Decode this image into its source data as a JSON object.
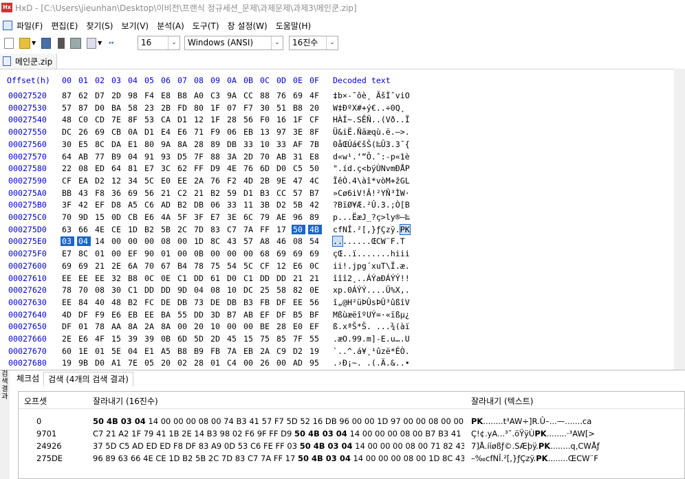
{
  "window": {
    "title": "HxD - [C:\\Users\\jieunhan\\Desktop\\이비전\\프랜식 정규세션_문제\\과제문제\\과제3\\메인쿤.zip]"
  },
  "menu": [
    "파일(F)",
    "편집(E)",
    "찾기(S)",
    "보기(V)",
    "분석(A)",
    "도구(T)",
    "창 설정(W)",
    "도움말(H)"
  ],
  "toolbar": {
    "bytes_per_row": "16",
    "charset": "Windows (ANSI)",
    "offset_base": "16진수"
  },
  "file_tab": "메인쿤.zip",
  "hex_header": {
    "offset": "Offset(h)",
    "cols": [
      "00",
      "01",
      "02",
      "03",
      "04",
      "05",
      "06",
      "07",
      "08",
      "09",
      "0A",
      "0B",
      "0C",
      "0D",
      "0E",
      "0F"
    ],
    "decoded": "Decoded text"
  },
  "rows": [
    {
      "off": "00027520",
      "b": "87 62 D7 2D 98 F4 E8 B8 A0 C3 9A CC 88 76 69 4F",
      "t": "‡b×-˜ôè¸ ÃšÌˆviO"
    },
    {
      "off": "00027530",
      "b": "57 87 D0 BA 58 23 2B FD 80 1F 07 F7 30 51 B8 20",
      "t": "W‡ÐºX#+ý€..÷0Q¸ "
    },
    {
      "off": "00027540",
      "b": "48 C0 CD 7E 8F 53 CA D1 12 1F 28 56 F0 16 1F CF",
      "t": "HÀÍ~.SÊÑ..(Vð..Ï"
    },
    {
      "off": "00027550",
      "b": "DC 26 69 CB 0A D1 E4 E6 71 F9 06 EB 13 97 3E 8F",
      "t": "Ü&iË.Ñäæqù.ë.—>."
    },
    {
      "off": "00027560",
      "b": "30 E5 8C DA E1 80 9A 8A 28 89 DB 33 10 33 AF 7B",
      "t": "0åŒÚá€šŠ(‰Û3.3¯{"
    },
    {
      "off": "00027570",
      "b": "64 AB 77 B9 04 91 93 D5 7F 88 3A 2D 70 AB 31 E8",
      "t": "d«w¹.‘“Õ.ˆ:-p«1è"
    },
    {
      "off": "00027580",
      "b": "22 08 ED 64 81 E7 3C 62 FF D9 4E 76 6D D0 C5 50",
      "t": "\".íd.ç<bÿÙNvmÐÅP"
    },
    {
      "off": "00027590",
      "b": "CF EA D2 12 34 5C E0 EE 2A 76 F2 4D 2B 9E 47 4C",
      "t": "ÏêÒ.4\\àî*vòM+žGL"
    },
    {
      "off": "000275A0",
      "b": "BB 43 F8 36 69 56 21 C2 21 B2 59 D1 B3 CC 57 B7",
      "t": "»Cø6iV!Â!²YÑ³ÌW·"
    },
    {
      "off": "000275B0",
      "b": "3F 42 EF D8 A5 C6 AD B2 DB 06 33 11 3B D2 5B 42",
      "t": "?BïØ¥Æ.²Û.3.;Ò[B"
    },
    {
      "off": "000275C0",
      "b": "70 9D 15 0D CB E6 4A 5F 3F E7 3E 6C 79 AE 96 89",
      "t": "p...ËæJ_?ç>ly®–‰"
    },
    {
      "off": "000275D0",
      "b": "63 66 4E CE 1D B2 5B 2C 7D 83 C7 7A FF 17 50 4B",
      "t": "cfNÎ.²[,}ƒÇzÿ.PK"
    },
    {
      "off": "000275E0",
      "b": "03 04 14 00 00 00 08 00 1D 8C 43 57 A8 46 08 54",
      "t": "........ŒCW¨F.T"
    },
    {
      "off": "000275F0",
      "b": "E7 8C 01 00 EF 90 01 00 0B 00 00 00 68 69 69 69",
      "t": "çŒ..ï.......hiii"
    },
    {
      "off": "00027600",
      "b": "69 69 21 2E 6A 70 67 B4 78 75 54 5C CF 12 E6 0C",
      "t": "ii!.jpg´xuT\\Ï.æ."
    },
    {
      "off": "00027610",
      "b": "EE EE EE 32 B8 0C 0E C1 DD 61 D0 C1 DD DD 21 21",
      "t": "îîî2¸..ÁÝaÐÁÝÝ!!"
    },
    {
      "off": "00027620",
      "b": "78 70 08 30 C1 DD DD 9D 04 08 10 DC 25 58 82 0E",
      "t": "xp.0ÁÝÝ....Ü%X,."
    },
    {
      "off": "00027630",
      "b": "EE 84 40 48 B2 FC DE DB 73 DE DB B3 FB DF EE 56",
      "t": "î„@H²üÞÛsÞÛ³ûßîV"
    },
    {
      "off": "00027640",
      "b": "4D DF F9 E6 EB EE BA 55 DD 3D B7 AB EF DF B5 BF",
      "t": "MßùæëîºUÝ=·«ïßµ¿"
    },
    {
      "off": "00027650",
      "b": "DF 01 78 AA 8A 2A 8A 00 20 10 00 00 BE 28 E0 EF",
      "t": "ß.xªŠ*Š. ...¾(àï"
    },
    {
      "off": "00027660",
      "b": "2E E6 4F 15 39 39 0B 6D 5D 2D 45 15 75 85 7F 55",
      "t": ".æO.99.m]-E.u….U"
    },
    {
      "off": "00027670",
      "b": "60 1E 01 5E 04 E1 A5 B8 B9 FB 7A EB 2A C9 D2 19",
      "t": "`..^.á¥¸¹ûzë*ÉÒ."
    },
    {
      "off": "00027680",
      "b": "19 9B D0 A1 7E 05 20 02 28 01 C4 00 26 00 AD 95",
      "t": ".›Ð¡~. .(.Ä.&..•"
    },
    {
      "off": "00027690",
      "b": "8D 8F 27 E0 7F 17 E0 7F E0 8F 95 7F FF 5A E4 FA",
      "t": "..'à..à.à.•.ÿZäú"
    },
    {
      "off": "000276A0",
      "b": "E7 CA FE 53 72 BB F1 06 D2 10 28 FB B4 3F 11 29",
      "t": "çÊþSr»ñ.Ò.(û´?.)"
    }
  ],
  "bottom_panel": {
    "side_label": "검색 결과",
    "tabs": [
      "체크섬",
      "검색 (4개의 검색 결과)"
    ],
    "columns": [
      "오프셋",
      "잘라내기 (16진수)",
      "잘라내기 (텍스트)"
    ],
    "results": [
      {
        "off": "0",
        "pre": "",
        "bold": "50 4B 03 04",
        "post": " 14 00 00 00 08 00 74 B3 41 57 F7 5D 52 16 DB 96 00 00 1D 97 00 00 08 00 00 ...",
        "tpre": "",
        "tbold": "PK",
        "tpost": "........t³AW÷]R.Û–...—.......ca"
      },
      {
        "off": "9701",
        "pre": "C7 21 A2 1F 79 41 1B 2E 14 B3 98 02 F6 9F FF D9 ",
        "bold": "50 4B 03 04",
        "post": " 14 00 00 00 08 00 B7 B3 41 5...",
        "tpre": "Ç!¢.yA...³˜.öŸÿÙ",
        "tbold": "PK",
        "tpost": "........·³AW[>"
      },
      {
        "off": "24926",
        "pre": "37 5D C5 AD ED ED F8 DF 83 A9 0D 53 C6 FE FF 03 ",
        "bold": "50 4B 03 04",
        "post": " 14 00 00 00 08 00 71 82 43...",
        "tpre": "7]Å.ííøßƒ©.SÆþÿ.",
        "tbold": "PK",
        "tpost": "........q‚CWÅƒ"
      },
      {
        "off": "275DE",
        "pre": "96 89 63 66 4E CE 1D B2 5B 2C 7D 83 C7 7A FF 17 ",
        "bold": "50 4B 03 04",
        "post": " 14 00 00 00 08 00 1D 8C 43 ...",
        "tpre": "–‰cfNÎ.²[,}ƒÇzÿ.",
        "tbold": "PK",
        "tpost": "........ŒCW¨F"
      }
    ]
  }
}
